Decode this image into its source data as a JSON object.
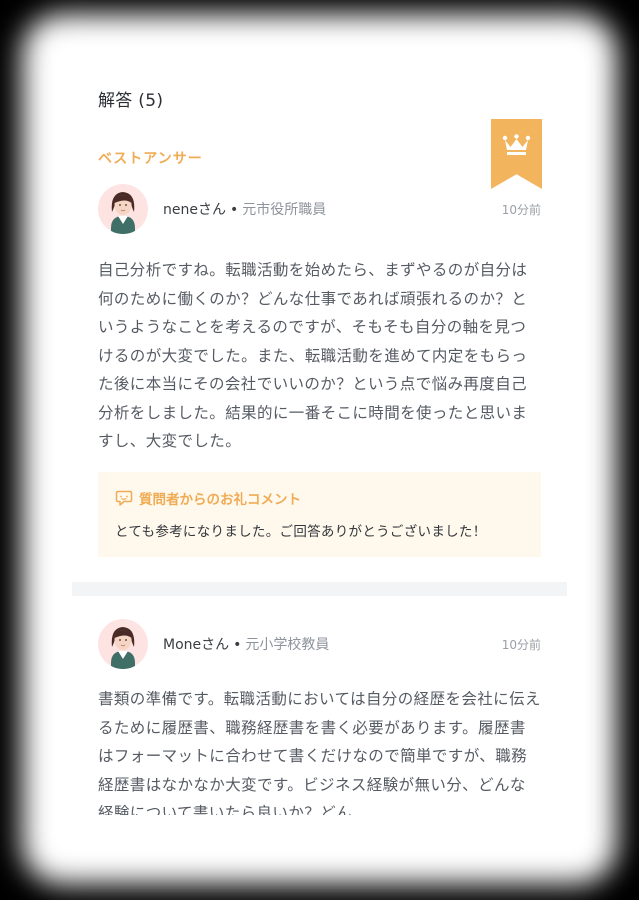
{
  "answers_section": {
    "title": "解答 (5)",
    "best_answer_label": "ベストアンサー",
    "badge_icon": "crown-icon",
    "accent_color": "#f2b55e"
  },
  "answers": [
    {
      "name": "neneさん",
      "role": "元市役所職員",
      "time": "10分前",
      "avatar_icon": "woman-avatar-icon",
      "body": "自己分析ですね。転職活動を始めたら、まずやるのが自分は何のために働くのか？どんな仕事であれば頑張れるのか？というようなことを考えるのですが、そもそも自分の軸を見つけるのが大変でした。また、転職活動を進めて内定をもらった後に本当にその会社でいいのか？という点で悩み再度自己分析をしました。結果的に一番そこに時間を使ったと思いますし、大変でした。",
      "thanks": {
        "title": "質問者からのお礼コメント",
        "icon": "speech-bubble-icon",
        "text": "とても参考になりました。ご回答ありがとうございました！"
      }
    },
    {
      "name": "Moneさん",
      "role": "元小学校教員",
      "time": "10分前",
      "avatar_icon": "woman-avatar-icon",
      "body": "書類の準備です。転職活動においては自分の経歴を会社に伝えるために履歴書、職務経歴書を書く必要があります。履歴書はフォーマットに合わせて書くだけなので簡単ですが、職務経歴書はなかなか大変です。ビジネス経験が無い分、どんな経験について書いたら良いか？どん"
    }
  ]
}
